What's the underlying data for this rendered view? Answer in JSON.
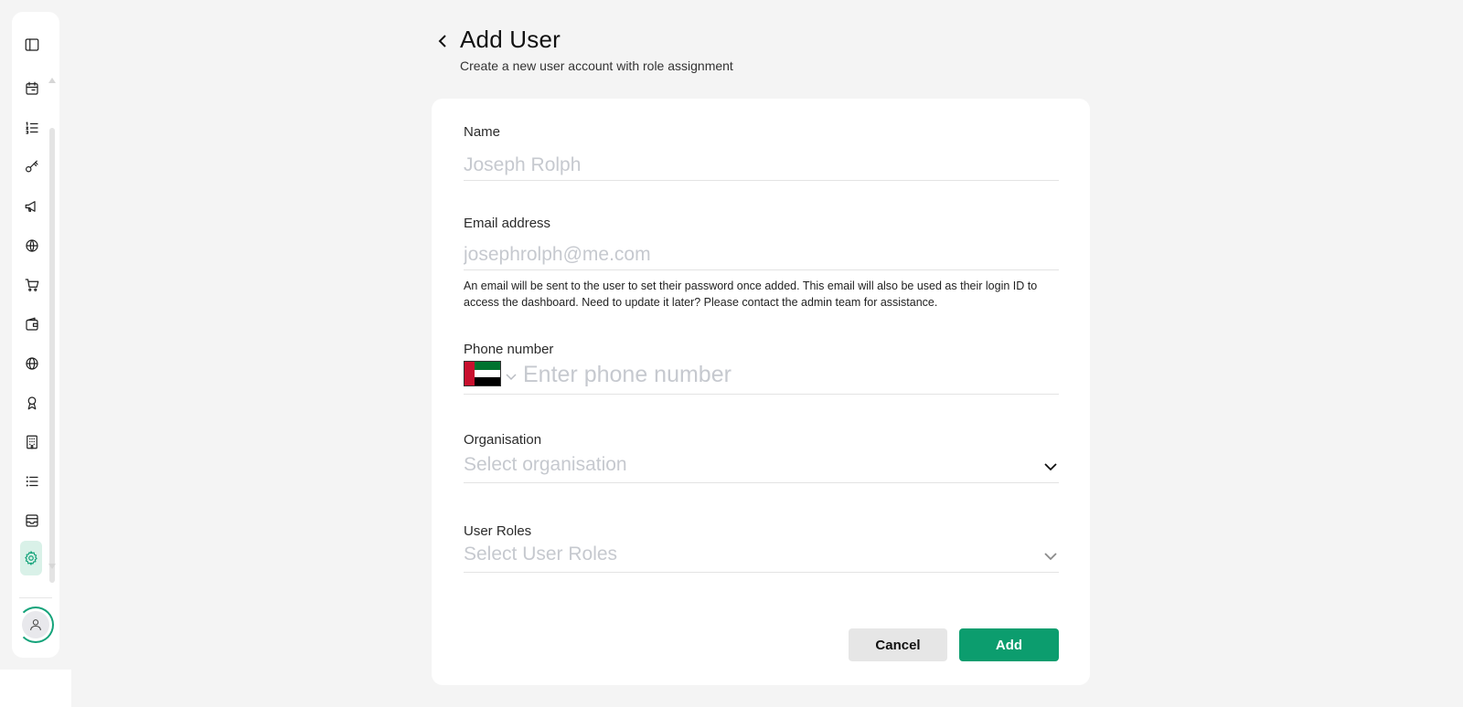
{
  "header": {
    "title": "Add User",
    "subtitle": "Create a new user account with role assignment"
  },
  "sidebar": {
    "items": [
      {
        "name": "calendar-icon"
      },
      {
        "name": "list-ordered-icon"
      },
      {
        "name": "key-icon"
      },
      {
        "name": "megaphone-icon"
      },
      {
        "name": "globe-pin-icon"
      },
      {
        "name": "cart-icon"
      },
      {
        "name": "wallet-icon"
      },
      {
        "name": "globe-icon"
      },
      {
        "name": "award-icon"
      },
      {
        "name": "building-icon"
      },
      {
        "name": "list-icon"
      },
      {
        "name": "inbox-icon"
      },
      {
        "name": "settings-icon",
        "active": true
      }
    ]
  },
  "form": {
    "name_label": "Name",
    "name_placeholder": "Joseph Rolph",
    "email_label": "Email address",
    "email_placeholder": "josephrolph@me.com",
    "email_helper": "An email will be sent to the user to set their password once added. This email will also be used as their login ID to access the dashboard. Need to update it later? Please contact the admin team for assistance.",
    "phone_label": "Phone number",
    "phone_placeholder": "Enter phone number",
    "phone_country_flag": "flag-uae-icon",
    "organisation_label": "Organisation",
    "organisation_placeholder": "Select organisation",
    "roles_label": "User Roles",
    "roles_placeholder": "Select User Roles"
  },
  "actions": {
    "cancel_label": "Cancel",
    "add_label": "Add"
  },
  "colors": {
    "accent": "#0c9d6e",
    "active_bg": "#d9f1e8",
    "placeholder": "#c6c9cf",
    "flag_red": "#c8102e",
    "flag_green": "#00732f",
    "flag_black": "#000000"
  }
}
